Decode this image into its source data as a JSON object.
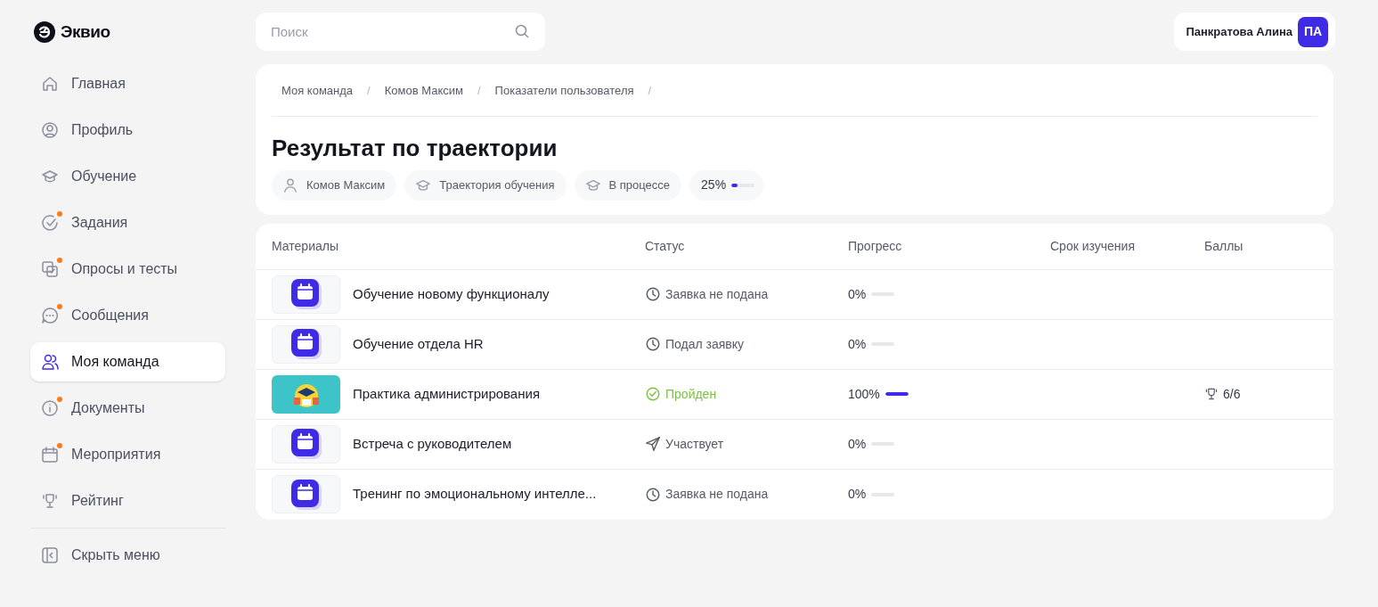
{
  "logo": {
    "text": "Эквио"
  },
  "sidebar": {
    "items": [
      {
        "kind": "home",
        "label": "Главная",
        "dot": false,
        "selected": false
      },
      {
        "kind": "profile",
        "label": "Профиль",
        "dot": false,
        "selected": false
      },
      {
        "kind": "learning",
        "label": "Обучение",
        "dot": false,
        "selected": false
      },
      {
        "kind": "tasks",
        "label": "Задания",
        "dot": true,
        "selected": false
      },
      {
        "kind": "tests",
        "label": "Опросы и тесты",
        "dot": true,
        "selected": false
      },
      {
        "kind": "messages",
        "label": "Сообщения",
        "dot": true,
        "selected": false
      },
      {
        "kind": "team",
        "label": "Моя команда",
        "dot": false,
        "selected": true
      },
      {
        "kind": "documents",
        "label": "Документы",
        "dot": true,
        "selected": false
      },
      {
        "kind": "events",
        "label": "Мероприятия",
        "dot": true,
        "selected": false
      },
      {
        "kind": "rating",
        "label": "Рейтинг",
        "dot": false,
        "selected": false
      }
    ],
    "collapse": {
      "label": "Скрыть меню"
    }
  },
  "search": {
    "placeholder": "Поиск"
  },
  "user": {
    "name": "Панкратова Алина",
    "initials": "ПА"
  },
  "breadcrumbs": [
    {
      "label": "Моя команда",
      "separator": "/"
    },
    {
      "label": "Комов Максим",
      "separator": "/"
    },
    {
      "label": "Показатели пользователя",
      "separator": "/"
    }
  ],
  "title": "Результат по траектории",
  "chips": [
    {
      "kind": "person",
      "label": "Комов Максим"
    },
    {
      "kind": "learning",
      "label": "Траектория обучения"
    },
    {
      "kind": "learning",
      "label": "В процессе"
    }
  ],
  "overall_progress": {
    "reading": "25%",
    "level": 0.25
  },
  "table": {
    "columns": [
      "Материалы",
      "Статус",
      "Прогресс",
      "Срок изучения",
      "Баллы"
    ],
    "rows": [
      {
        "kind": "event",
        "name": "Обучение новому функционалу",
        "status": {
          "kind": "waiting",
          "text": "Заявка не подана"
        },
        "progress": "0%",
        "level": 0
      },
      {
        "kind": "event",
        "name": "Обучение отдела HR",
        "status": {
          "kind": "waiting",
          "text": "Подал заявку"
        },
        "progress": "0%",
        "level": 0
      },
      {
        "kind": "course",
        "name": "Практика администрирования",
        "status": {
          "kind": "passed",
          "text": "Пройден"
        },
        "progress": "100%",
        "level": 1,
        "score": "6/6"
      },
      {
        "kind": "event",
        "name": "Встреча с руководителем",
        "status": {
          "kind": "participating",
          "text": "Участвует"
        },
        "progress": "0%",
        "level": 0
      },
      {
        "kind": "event",
        "name": "Тренинг по эмоциональному интелле...",
        "status": {
          "kind": "waiting",
          "text": "Заявка не подана"
        },
        "progress": "0%",
        "level": 0
      }
    ]
  }
}
